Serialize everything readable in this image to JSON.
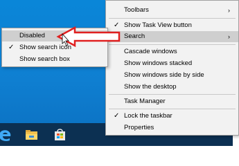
{
  "context_menu": {
    "items": [
      {
        "label": "Toolbars",
        "checked": false,
        "submenu": true
      },
      {
        "label": "Show Task View button",
        "checked": true,
        "submenu": false
      },
      {
        "label": "Search",
        "checked": false,
        "submenu": true,
        "highlighted": true
      },
      {
        "label": "Cascade windows",
        "checked": false,
        "submenu": false
      },
      {
        "label": "Show windows stacked",
        "checked": false,
        "submenu": false
      },
      {
        "label": "Show windows side by side",
        "checked": false,
        "submenu": false
      },
      {
        "label": "Show the desktop",
        "checked": false,
        "submenu": false
      },
      {
        "label": "Task Manager",
        "checked": false,
        "submenu": false
      },
      {
        "label": "Lock the taskbar",
        "checked": true,
        "submenu": false
      },
      {
        "label": "Properties",
        "checked": false,
        "submenu": false
      }
    ],
    "check_glyph": "✓",
    "arrow_glyph": "›"
  },
  "search_submenu": {
    "items": [
      {
        "label": "Disabled",
        "checked": false,
        "highlighted": true
      },
      {
        "label": "Show search icon",
        "checked": true
      },
      {
        "label": "Show search box",
        "checked": false
      }
    ]
  },
  "taskbar": {
    "icons": [
      "edge-icon",
      "file-explorer-icon",
      "store-icon"
    ]
  },
  "colors": {
    "desktop": "#0f7fd1",
    "taskbar": "#0c3052",
    "menu_bg": "#f2f2f2",
    "menu_highlight": "#cfcfcf",
    "annotation_red": "#e02020"
  }
}
